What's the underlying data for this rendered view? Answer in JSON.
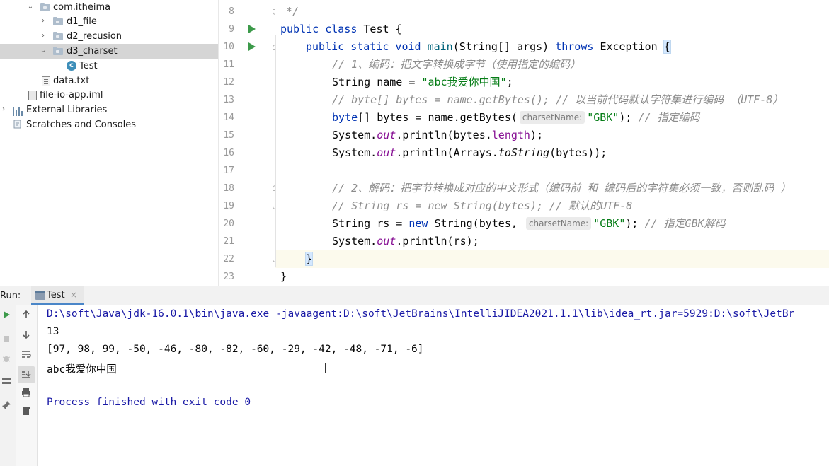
{
  "project_tree": {
    "items": [
      {
        "label": "com.itheima",
        "expanded": true
      },
      {
        "label": "d1_file",
        "expanded": false
      },
      {
        "label": "d2_recusion",
        "expanded": false
      },
      {
        "label": "d3_charset",
        "expanded": true,
        "selected": true
      },
      {
        "label": "Test",
        "icon_letter": "c"
      },
      {
        "label": "data.txt"
      },
      {
        "label": "file-io-app.iml"
      },
      {
        "label": "External Libraries",
        "expanded": false
      },
      {
        "label": "Scratches and Consoles"
      }
    ]
  },
  "editor": {
    "line_numbers": [
      "8",
      "9",
      "10",
      "11",
      "12",
      "13",
      "14",
      "15",
      "16",
      "17",
      "18",
      "19",
      "20",
      "21",
      "22",
      "23"
    ],
    "hint_label": "charsetName:",
    "lines": {
      "l8": "*/",
      "l9_a": "public class ",
      "l9_b": "Test {",
      "l10_a": "public static void ",
      "l10_b": "main",
      "l10_c": "(String[] args) ",
      "l10_d": "throws ",
      "l10_e": "Exception ",
      "l10_f": "{",
      "l11": "// 1、编码：把文字转换成字节（使用指定的编码）",
      "l12_a": "String name = ",
      "l12_b": "\"abc我爱你中国\"",
      "l12_c": ";",
      "l13": "// byte[] bytes = name.getBytes(); // 以当前代码默认字符集进行编码 （UTF-8）",
      "l14_a": "byte",
      "l14_b": "[] bytes = name.getBytes(",
      "l14_c": "\"GBK\"",
      "l14_d": "); ",
      "l14_e": "// 指定编码",
      "l15_a": "System.",
      "l15_b": "out",
      "l15_c": ".println(bytes.",
      "l15_d": "length",
      "l15_e": ");",
      "l16_a": "System.",
      "l16_b": "out",
      "l16_c": ".println(Arrays.",
      "l16_d": "toString",
      "l16_e": "(bytes));",
      "l18": "// 2、解码：把字节转换成对应的中文形式（编码前 和 编码后的字符集必须一致，否则乱码 ）",
      "l19": "// String rs = new String(bytes); // 默认的UTF-8",
      "l20_a": "String rs = ",
      "l20_b": "new ",
      "l20_c": "String(bytes, ",
      "l20_d": "\"GBK\"",
      "l20_e": "); ",
      "l20_f": "// 指定GBK解码",
      "l21_a": "System.",
      "l21_b": "out",
      "l21_c": ".println(rs);",
      "l22": "}",
      "l23": "}"
    }
  },
  "run_panel": {
    "label": "Run:",
    "tab_label": "Test",
    "tab_close": "×",
    "output": [
      "D:\\soft\\Java\\jdk-16.0.1\\bin\\java.exe -javaagent:D:\\soft\\JetBrains\\IntelliJIDEA2021.1.1\\lib\\idea_rt.jar=5929:D:\\soft\\JetBr",
      "13",
      "[97, 98, 99, -50, -46, -80, -82, -60, -29, -42, -48, -71, -6]",
      "abc我爱你中国",
      "",
      "Process finished with exit code 0"
    ]
  },
  "colors": {
    "keyword": "#0033b3",
    "string": "#067d17",
    "comment": "#8c8c8c",
    "static_field": "#871094",
    "run_arrow": "#3c9a4a",
    "console_info": "#1a1aa6"
  }
}
